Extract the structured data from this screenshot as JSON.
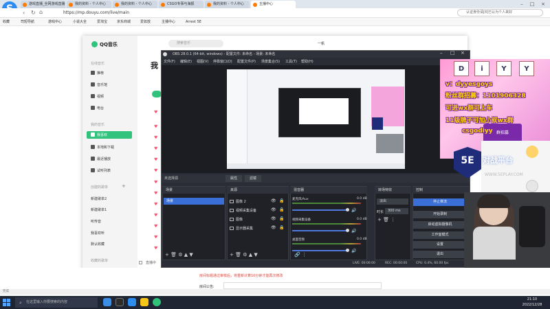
{
  "browser": {
    "tabs": [
      {
        "label": "游戏直播_全网游戏直播"
      },
      {
        "label": "我的资料 - 个人中心"
      },
      {
        "label": "我的资料 - 个人中心"
      },
      {
        "label": "CSGO专事与海报"
      },
      {
        "label": "我的资料 - 个人中心"
      },
      {
        "label": "主播中心"
      }
    ],
    "url": "https://mp.douyu.com/live/main",
    "search_placeholder": "认证身份请[8]已认为个人来好",
    "bookmarks": [
      "收藏",
      "司短导航",
      "游戏中心",
      "小说大全",
      "爱淘宝",
      "京东商城",
      "爱如放",
      "主播中心",
      "Arrest 5E"
    ]
  },
  "qqmusic": {
    "title": "QQ音乐",
    "search_placeholder": "搜索音乐",
    "user": "一帆",
    "section_online": "在线音乐",
    "nav": [
      "推荐",
      "音乐馆",
      "视频",
      "电台"
    ],
    "section_mine": "我的音乐",
    "my_nav": [
      "我喜欢",
      "本地和下载",
      "最近播放",
      "试听列表"
    ],
    "section_created": "创建的歌单",
    "playlists": [
      "新建歌单2",
      "新建歌单1",
      "听传音",
      "我喜欢听",
      "默认收藏"
    ],
    "section_fav": "收藏的歌单",
    "page_heading": "我"
  },
  "obs": {
    "title": "OBS 28.0.1 (64-bit, windows) - 配置文件: 未命名 - 场景: 未命名",
    "menu": [
      "文件(F)",
      "编辑(E)",
      "视图(V)",
      "停靠窗口(D)",
      "配置文件(P)",
      "场景集合(S)",
      "工具(T)",
      "帮助(H)"
    ],
    "no_source": "未选择源",
    "source_buttons": [
      "属性",
      "滤镜"
    ],
    "docks": {
      "scenes": "场景",
      "sources": "来源",
      "mixer": "混音器",
      "transitions": "转场特效",
      "controls": "控制"
    },
    "scene_list": [
      "场景"
    ],
    "source_list": [
      "图像 2",
      "视频采集设备",
      "图像",
      "显示器采集"
    ],
    "mixer": [
      {
        "name": "麦克风/Aux",
        "db": "0.0 dB"
      },
      {
        "name": "视频采集设备",
        "db": "0.0 dB"
      },
      {
        "name": "桌面音频",
        "db": "0.0 dB"
      }
    ],
    "transition": {
      "type": "淡出",
      "duration_label": "时长",
      "duration": "300 ms"
    },
    "controls": [
      "停止推流",
      "开始录制",
      "启动虚拟摄像机",
      "工作室模式",
      "设置",
      "退出"
    ],
    "status": {
      "live": "LIVE: 00:00:00",
      "rec": "REC: 00:00:00",
      "cpu": "CPU: 0.4%, 60.00 fps"
    }
  },
  "overlay": {
    "cards": [
      "D",
      "i",
      "Y",
      "Y"
    ],
    "lines": [
      "v：dyyesgoys",
      "粉丝群招募：1101906328",
      "可进wx群可上车",
      "11级牌子可加小叔wx群",
      "csgodiyy"
    ],
    "banner": "群招募",
    "logo": "5E",
    "ad_text": "对战平台",
    "ad_sub": "WWW.5EPLAY.COM"
  },
  "page": {
    "notice": "房间标题通过审核后，将重新计算10分钟才能再次修改",
    "room_announcement": "房间公告:",
    "live_label": "直播中"
  },
  "status_bar": "完成",
  "taskbar": {
    "search_placeholder": "在这里输入你要搜索的内容",
    "time": "21:10",
    "date": "2022/12/28"
  },
  "colors": {
    "qq_green": "#31c27c",
    "obs_bg": "#2a2d35",
    "obs_accent": "#3a6fd8",
    "taskbar": "#1f2533"
  }
}
